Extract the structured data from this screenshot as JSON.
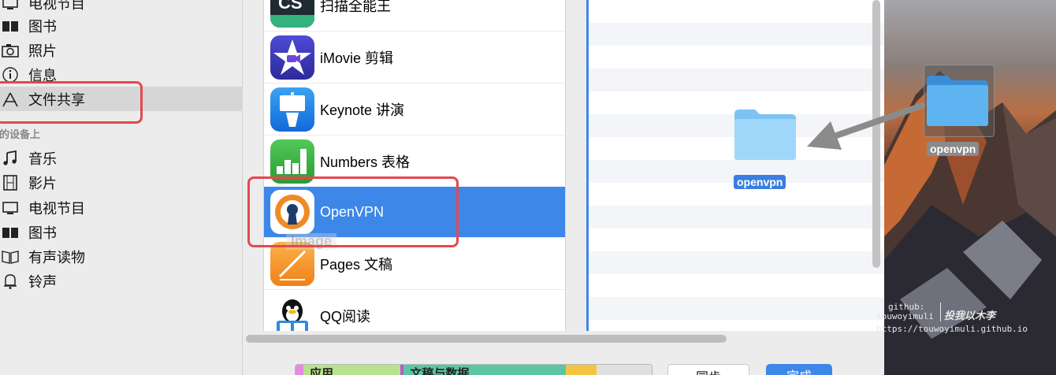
{
  "sidebar": {
    "items_top": [
      {
        "label": "电视节目",
        "icon": "tv-icon"
      },
      {
        "label": "图书",
        "icon": "book-icon"
      },
      {
        "label": "照片",
        "icon": "camera-icon"
      },
      {
        "label": "信息",
        "icon": "info-icon"
      },
      {
        "label": "文件共享",
        "icon": "app-store-icon"
      }
    ],
    "section_title": "我的设备上",
    "items_device": [
      {
        "label": "音乐",
        "icon": "music-note-icon"
      },
      {
        "label": "影片",
        "icon": "film-icon"
      },
      {
        "label": "电视节目",
        "icon": "tv-icon"
      },
      {
        "label": "图书",
        "icon": "book-icon"
      },
      {
        "label": "有声读物",
        "icon": "audiobook-icon"
      },
      {
        "label": "铃声",
        "icon": "bell-icon"
      }
    ]
  },
  "apps": [
    {
      "name": "扫描全能王"
    },
    {
      "name": "iMovie 剪辑"
    },
    {
      "name": "Keynote 讲演"
    },
    {
      "name": "Numbers 表格"
    },
    {
      "name": "OpenVPN"
    },
    {
      "name": "Pages 文稿"
    },
    {
      "name": "QQ阅读"
    }
  ],
  "drag_ghost_text": "Image",
  "documents": {
    "folder_label": "openvpn"
  },
  "desktop": {
    "folder_label": "openvpn",
    "watermark_line1": "github:",
    "watermark_line2": "touwoyimuli",
    "watermark_line3": "https://touwoyimuli.github.io",
    "watermark_cn": "投我以木李"
  },
  "storage_bar": {
    "apps_label": "应用",
    "docs_label": "文稿与数据"
  },
  "buttons": {
    "sync_label": "同步",
    "done_label": "完成"
  },
  "colors": {
    "selection": "#3d87e8",
    "highlight_box": "#e5484d",
    "apps_segment": "#b7e38c",
    "docs_segment": "#5cc6a3",
    "other_segment": "#f4c542"
  }
}
